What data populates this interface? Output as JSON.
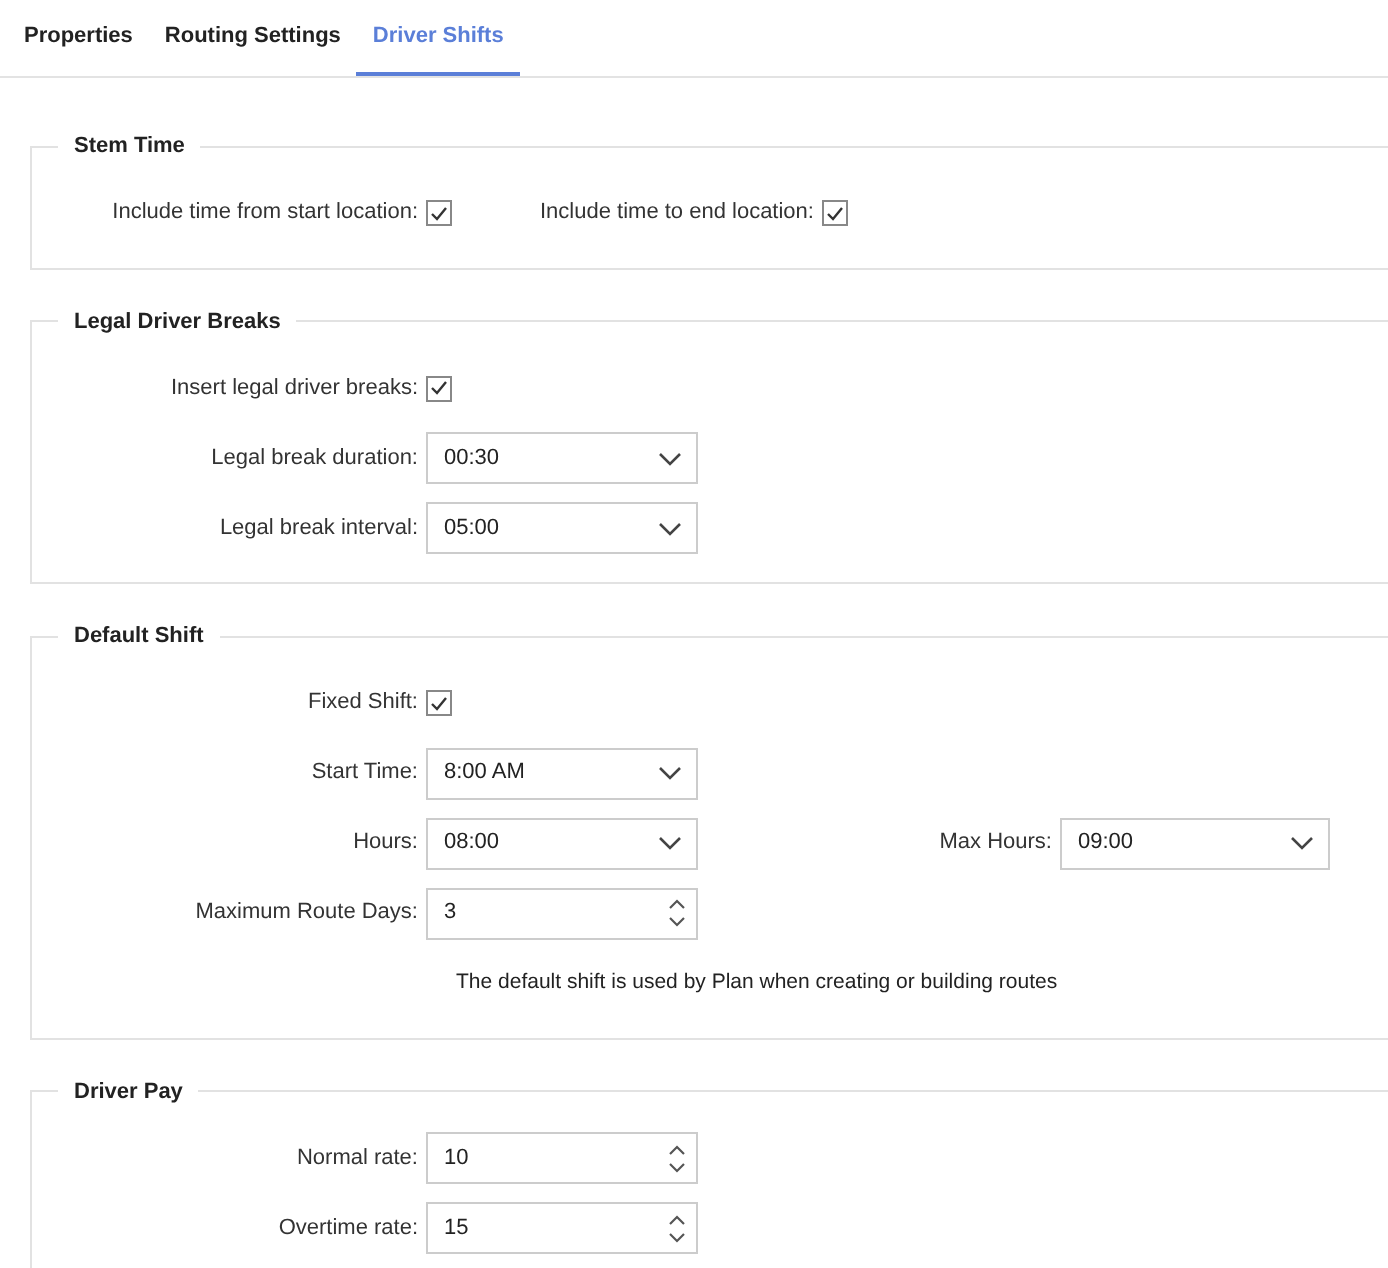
{
  "tabs": [
    {
      "label": "Properties",
      "selected": false
    },
    {
      "label": "Routing Settings",
      "selected": false
    },
    {
      "label": "Driver Shifts",
      "selected": true
    }
  ],
  "sections": [
    {
      "title": "Stem Time",
      "rows": [
        [
          {
            "kind": "checkbox",
            "label": "Include time from start location:",
            "checked": true
          },
          {
            "kind": "checkbox",
            "label": "Include time to end location:",
            "checked": true
          }
        ]
      ]
    },
    {
      "title": "Legal Driver Breaks",
      "rows": [
        [
          {
            "kind": "checkbox",
            "label": "Insert legal driver breaks:",
            "checked": true
          }
        ],
        [
          {
            "kind": "select",
            "label": "Legal break duration:",
            "value": "00:30"
          }
        ],
        [
          {
            "kind": "select",
            "label": "Legal break interval:",
            "value": "05:00"
          }
        ]
      ]
    },
    {
      "title": "Default Shift",
      "rows": [
        [
          {
            "kind": "checkbox",
            "label": "Fixed Shift:",
            "checked": true
          }
        ],
        [
          {
            "kind": "select",
            "label": "Start Time:",
            "value": "8:00 AM"
          }
        ],
        [
          {
            "kind": "select",
            "label": "Hours:",
            "value": "08:00"
          },
          {
            "kind": "select",
            "label": "Max Hours:",
            "value": "09:00"
          }
        ],
        [
          {
            "kind": "number",
            "label": "Maximum Route Days:",
            "value": "3"
          }
        ],
        [
          {
            "kind": "note",
            "label": "The default shift is used by Plan when creating or building routes"
          }
        ]
      ]
    },
    {
      "title": "Driver Pay",
      "rows": [
        [
          {
            "kind": "number",
            "label": "Normal rate:",
            "value": "10"
          }
        ],
        [
          {
            "kind": "number",
            "label": "Overtime rate:",
            "value": "15"
          }
        ]
      ]
    }
  ]
}
